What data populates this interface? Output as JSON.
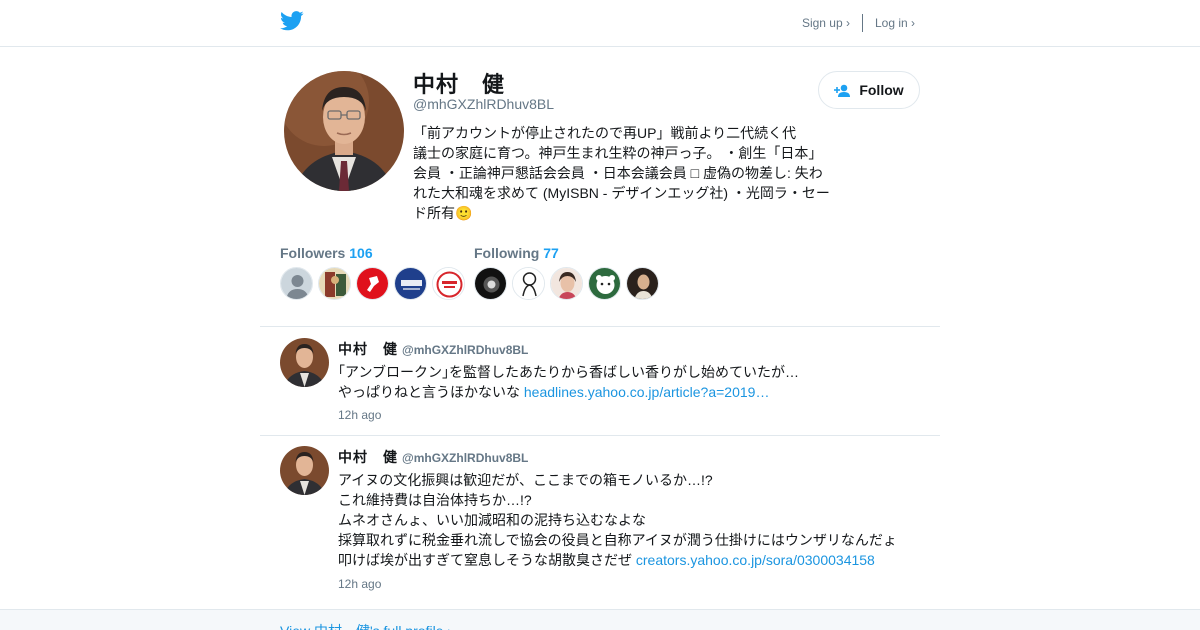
{
  "header": {
    "logo_icon": "twitter-bird-icon",
    "signup_label": "Sign up ›",
    "login_label": "Log in ›"
  },
  "profile": {
    "name": "中村　健",
    "handle": "@mhGXZhlRDhuv8BL",
    "bio_lines": [
      "「前アカウントが停止されたので再UP」戦前より二代続く代",
      "議士の家庭に育つ。神戸生まれ生粋の神戸っ子。 ・創生「日本」",
      "会員 ・正論神戸懇話会会員 ・日本会議会員 □ 虚偽の物差し: 失わ",
      "れた大和魂を求めて (MyISBN - デザインエッグ社) ・光岡ラ・セー",
      "ド所有🙂"
    ],
    "follow_label": "Follow"
  },
  "stats": {
    "followers_label": "Followers",
    "followers_count": "106",
    "following_label": "Following",
    "following_count": "77"
  },
  "tweets": [
    {
      "name": "中村　健",
      "handle": "@mhGXZhlRDhuv8BL",
      "line1": "｢アンブロークン｣を監督したあたりから香ばしい香りがし始めていたが…",
      "line2_text": "やっぱりねと言うほかないな ",
      "line2_link": "headlines.yahoo.co.jp/article?a=2019…",
      "time": "12h ago"
    },
    {
      "name": "中村　健",
      "handle": "@mhGXZhlRDhuv8BL",
      "line1": "アイヌの文化振興は歓迎だが、ここまでの箱モノいるか…!?",
      "line2": "これ維持費は自治体持ちか…!?",
      "line3": "ムネオさんょ、いい加減昭和の泥持ち込むなよな",
      "line4": "採算取れずに税金垂れ流しで協会の役員と自称アイヌが潤う仕掛けにはウンザリなんだょ",
      "line5_text": "叩けば埃が出すぎて窒息しそうな胡散臭さだぜ ",
      "line5_link": "creators.yahoo.co.jp/sora/0300034158",
      "time": "12h ago"
    }
  ],
  "footer": {
    "full_profile_link": "View 中村　健's full profile ›"
  }
}
